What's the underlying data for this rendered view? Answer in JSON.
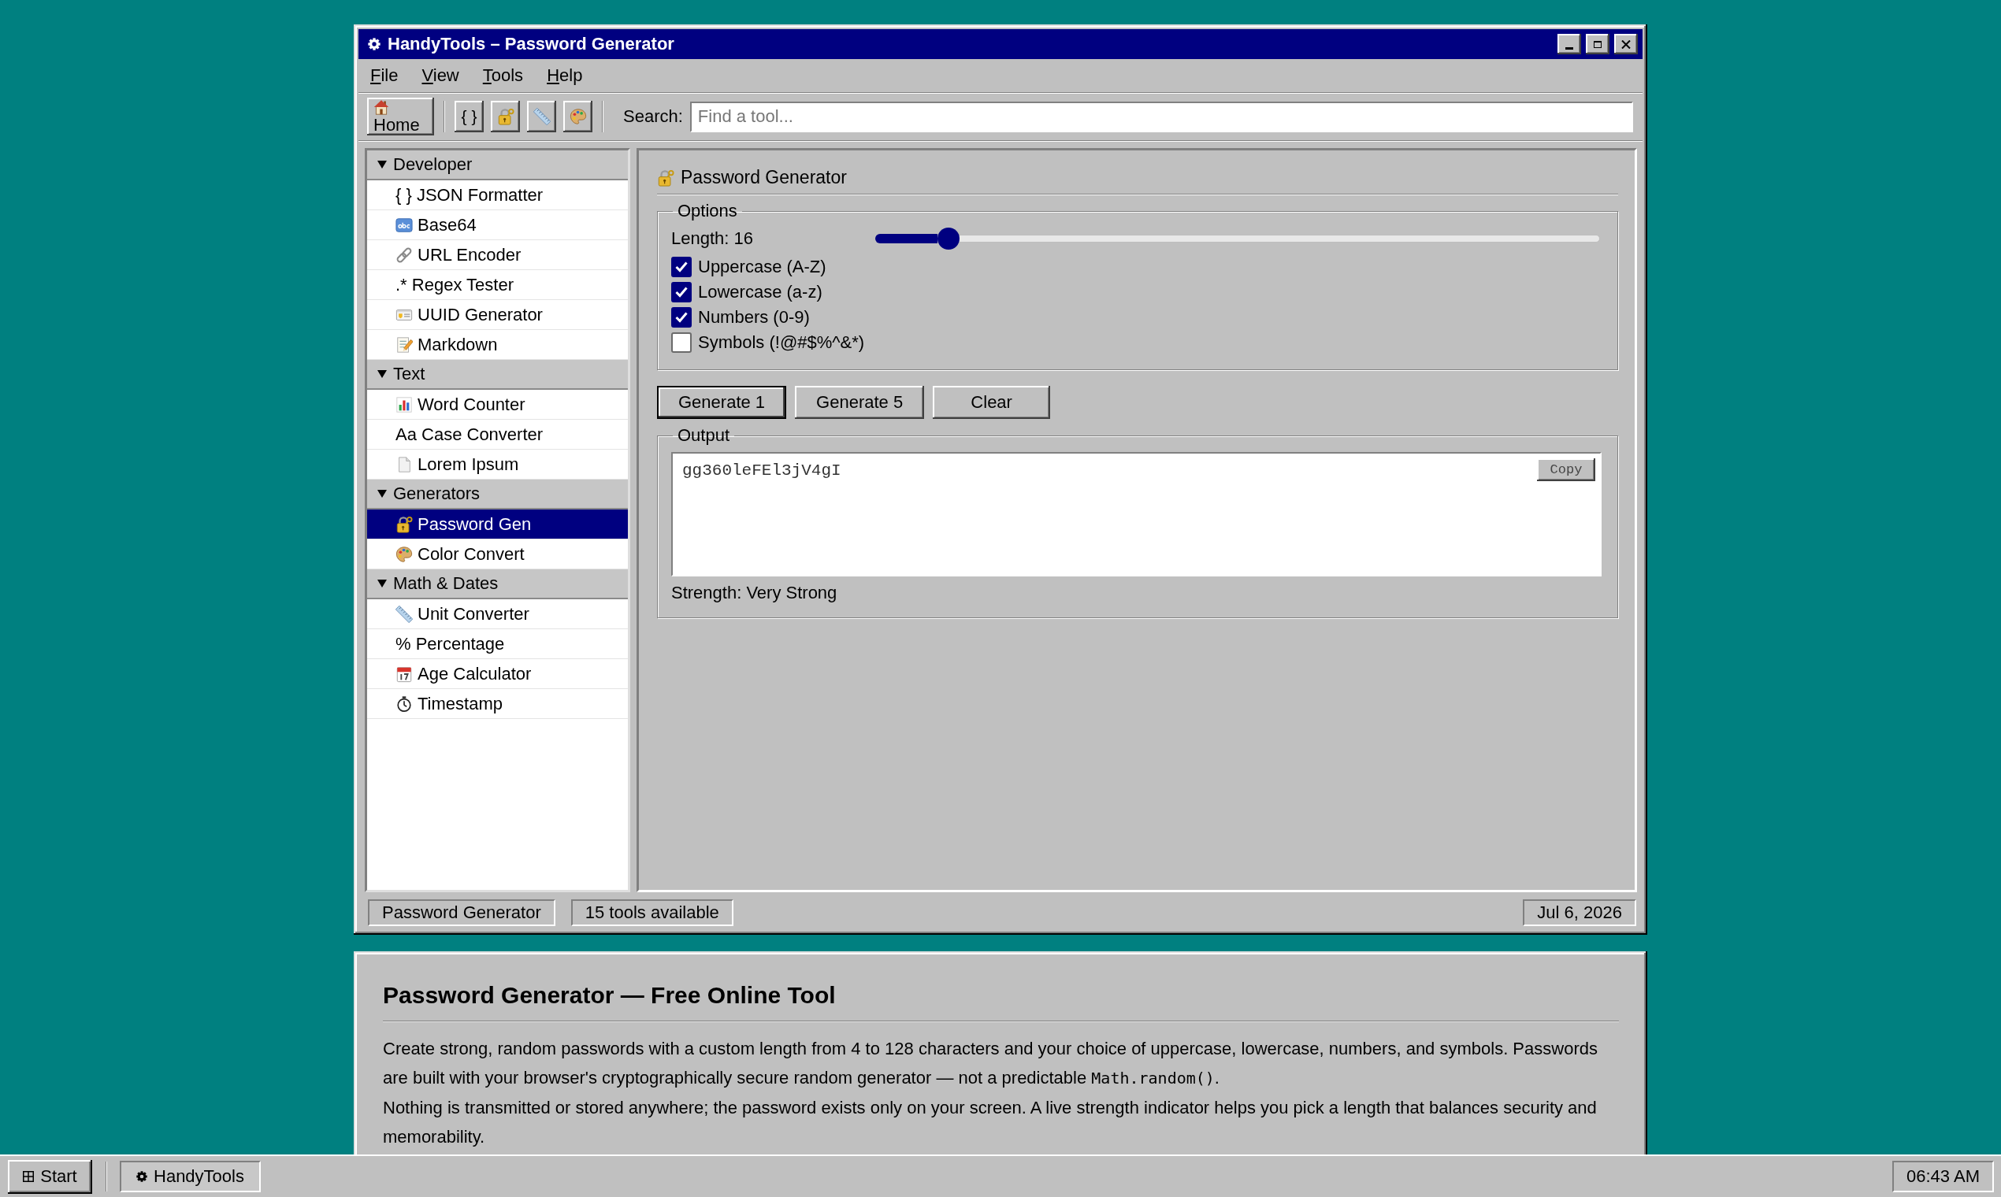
{
  "window": {
    "title": "HandyTools – Password Generator"
  },
  "menu": [
    "File",
    "View",
    "Tools",
    "Help"
  ],
  "toolbar": {
    "home_button": "Home",
    "text_button": "{ }",
    "search_label": "Search:",
    "search_placeholder": "Find a tool..."
  },
  "sidebar": {
    "groups": [
      {
        "label": "Developer",
        "expanded": true,
        "items": [
          {
            "label": "{ } JSON Formatter",
            "selected": false
          },
          {
            "label": "Base64",
            "selected": false
          },
          {
            "label": "URL Encoder",
            "selected": false
          },
          {
            "label": ".* Regex Tester",
            "selected": false
          },
          {
            "label": "UUID Generator",
            "selected": false
          },
          {
            "label": "Markdown",
            "selected": false
          }
        ]
      },
      {
        "label": "Text",
        "expanded": true,
        "items": [
          {
            "label": "Word Counter",
            "selected": false
          },
          {
            "label": "Aa Case Converter",
            "selected": false
          },
          {
            "label": "Lorem Ipsum",
            "selected": false
          }
        ]
      },
      {
        "label": "Generators",
        "expanded": true,
        "items": [
          {
            "label": "Password Gen",
            "selected": true
          },
          {
            "label": "Color Convert",
            "selected": false
          }
        ]
      },
      {
        "label": "Math & Dates",
        "expanded": true,
        "items": [
          {
            "label": "Unit Converter",
            "selected": false
          },
          {
            "label": "% Percentage",
            "selected": false
          },
          {
            "label": "Age Calculator",
            "selected": false
          },
          {
            "label": "Timestamp",
            "selected": false
          }
        ]
      }
    ]
  },
  "tool_panel": {
    "title": "Password Generator",
    "options": {
      "legend": "Options",
      "length_label": "Length: 16",
      "length_slider": {
        "level": 0.1
      },
      "checkboxes": [
        {
          "label": "Uppercase (A-Z)",
          "checked": true
        },
        {
          "label": "Lowercase (a-z)",
          "checked": true
        },
        {
          "label": "Numbers (0-9)",
          "checked": true
        },
        {
          "label": "Symbols (!@#$%^&*)",
          "checked": false
        }
      ]
    },
    "buttons": [
      {
        "label": "Generate 1",
        "default": true
      },
      {
        "label": "Generate 5",
        "default": false
      },
      {
        "label": "Clear",
        "default": false
      }
    ],
    "output": {
      "legend": "Output",
      "value": "gg360leFEl3jV4gI",
      "copy_button": "Copy",
      "strength": "Strength: Very Strong"
    }
  },
  "status_bar": [
    "Password Generator",
    "15 tools available",
    "Jul 6, 2026"
  ],
  "info_window": {
    "title": "Password Generator — Free Online Tool",
    "paragraphs": [
      [
        {
          "kind": "text",
          "text": "Create strong, random passwords with a custom length from 4 to 128 characters and your choice of uppercase, lowercase, numbers, and symbols. Passwords are built with your browser's cryptographically secure random generator — not a predictable "
        },
        {
          "kind": "code",
          "text": "Math.random()"
        },
        {
          "kind": "text",
          "text": "."
        }
      ],
      [
        {
          "kind": "text",
          "text": "Nothing is transmitted or stored anywhere; the password exists only on your screen. A live strength indicator helps you pick a length that balances security and memorability."
        }
      ]
    ]
  },
  "taskbar": {
    "start_button": "Start",
    "tasks": [
      {
        "label": "HandyTools",
        "active": true
      }
    ],
    "clock": "06:43 AM"
  }
}
